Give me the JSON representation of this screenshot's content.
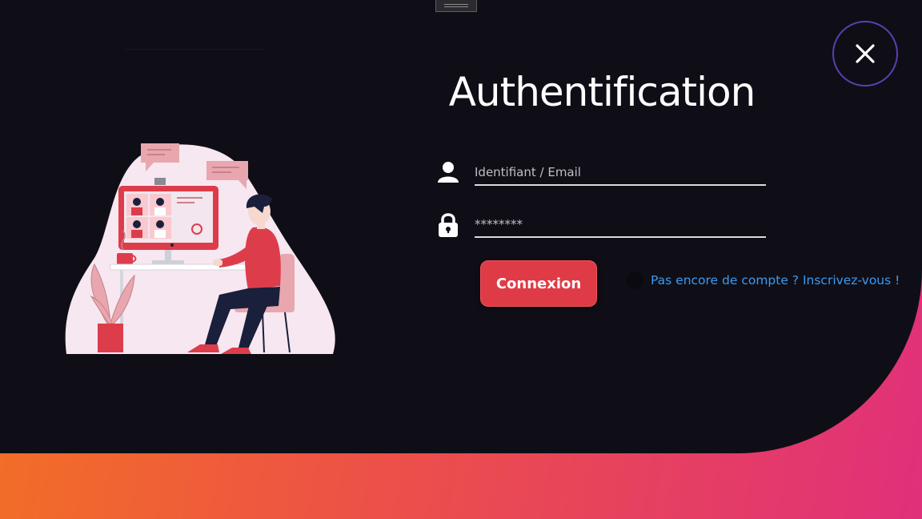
{
  "login": {
    "title": "Authentification",
    "username_placeholder": "Identifiant / Email",
    "password_placeholder": "********",
    "submit_label": "Connexion",
    "signup_link": "Pas encore de compte ? Inscrivez-vous !"
  },
  "icons": {
    "close": "close-icon",
    "user": "user-icon",
    "lock": "lock-icon"
  },
  "colors": {
    "background": "#0f0e17",
    "accent": "#df3b46",
    "link": "#3b9af0",
    "gradient": [
      "#f47321",
      "#ec5147",
      "#e0307a"
    ],
    "close_ring": "#5b3fb0"
  }
}
